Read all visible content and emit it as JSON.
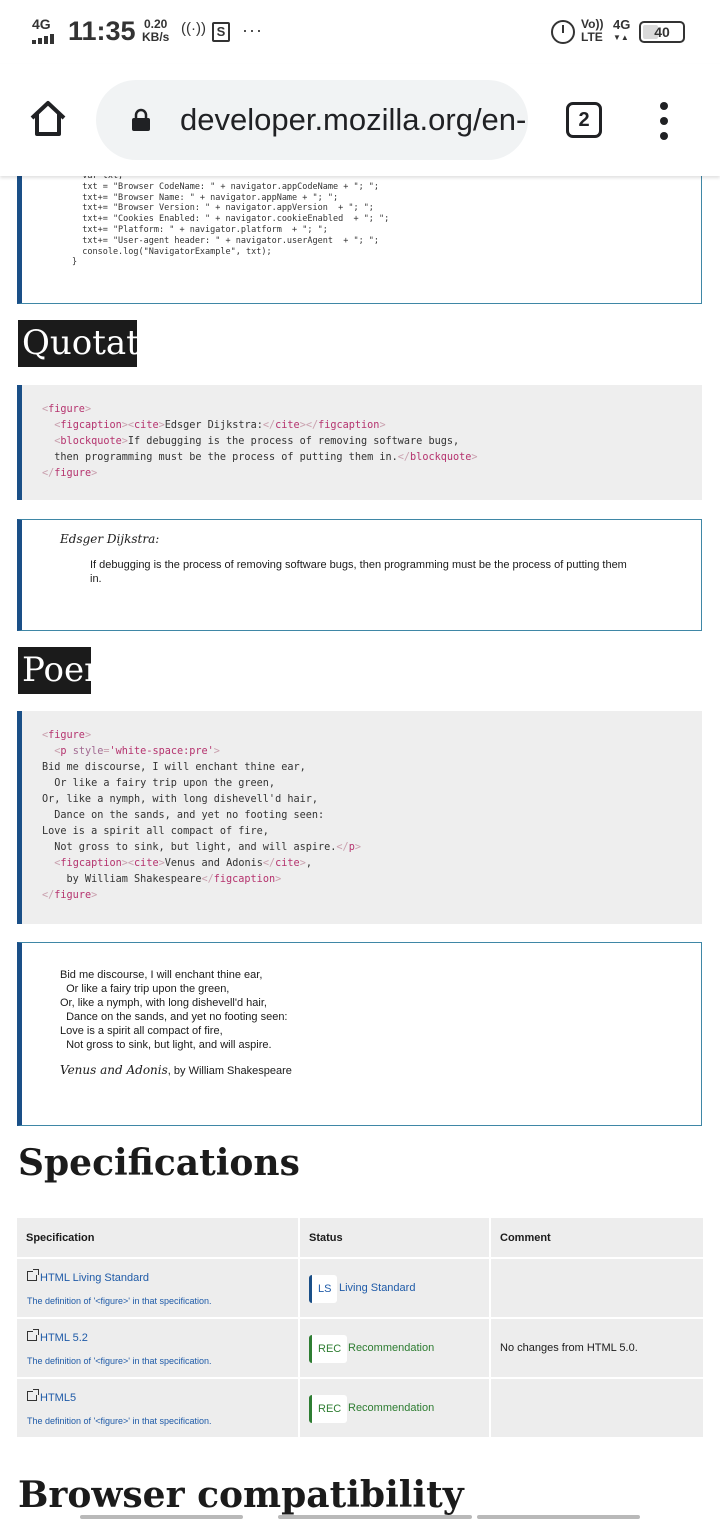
{
  "status_bar": {
    "network": "4G",
    "time": "11:35",
    "speed_value": "0.20",
    "speed_unit": "KB/s",
    "hotspot": "((·))",
    "sim_badge": "S",
    "more": "···",
    "volte_top": "Vo))",
    "volte_bottom": "LTE",
    "network2_top": "4G",
    "network2_bottom": "▼▲",
    "battery": "40",
    "battery_level_percent": 40
  },
  "browser": {
    "url": "developer.mozilla.org/en-US/docs/Web/HTML/Element/figure",
    "tab_count": "2"
  },
  "code_top": {
    "lines": [
      "  var txt;",
      "  txt = \"Browser CodeName: \" + navigator.appCodeName + \"; \";",
      "  txt+= \"Browser Name: \" + navigator.appName + \"; \";",
      "  txt+= \"Browser Version: \" + navigator.appVersion  + \"; \";",
      "  txt+= \"Cookies Enabled: \" + navigator.cookieEnabled  + \"; \";",
      "  txt+= \"Platform: \" + navigator.platform  + \"; \";",
      "  txt+= \"User-agent header: \" + navigator.userAgent  + \"; \";",
      "  console.log(\"NavigatorExample\", txt);",
      "}"
    ]
  },
  "quotation": {
    "heading": "Quotations",
    "code": {
      "l1_tag": "figure",
      "l2_tag1": "figcaption",
      "l2_tag2": "cite",
      "l2_text": "Edsger Dijkstra:",
      "l2_close1": "cite",
      "l2_close2": "figcaption",
      "l3_tag": "blockquote",
      "l3_text": "If debugging is the process of removing software bugs,",
      "l4_text": "then programming must be the process of putting them in.",
      "l4_close": "blockquote",
      "l5_close": "figure"
    },
    "demo": {
      "caption": "Edsger Dijkstra:",
      "quote": "If debugging is the process of removing software bugs, then programming must be the process of putting them in."
    }
  },
  "poem": {
    "heading": "Poems",
    "code": {
      "l1_tag": "figure",
      "l2_tag": "p",
      "l2_attr": "style",
      "l2_val": "'white-space:pre'",
      "lines": [
        "Bid me discourse, I will enchant thine ear,",
        "  Or like a fairy trip upon the green,",
        "Or, like a nymph, with long dishevell'd hair,",
        "  Dance on the sands, and yet no footing seen:",
        "Love is a spirit all compact of fire,"
      ],
      "l8_text": "  Not gross to sink, but light, and will aspire.",
      "l8_close": "p",
      "l9_tag1": "figcaption",
      "l9_tag2": "cite",
      "l9_text": "Venus and Adonis",
      "l9_close": "cite",
      "l9_comma": ",",
      "l10_text": "    by William Shakespeare",
      "l10_close": "figcaption",
      "l11_close": "figure"
    },
    "demo": {
      "text": "Bid me discourse, I will enchant thine ear,\n  Or like a fairy trip upon the green,\nOr, like a nymph, with long dishevell'd hair,\n  Dance on the sands, and yet no footing seen:\nLove is a spirit all compact of fire,\n  Not gross to sink, but light, and will aspire.",
      "cite": "Venus and Adonis",
      "by": ", by William Shakespeare"
    }
  },
  "specifications": {
    "heading": "Specifications",
    "columns": [
      "Specification",
      "Status",
      "Comment"
    ],
    "rows": [
      {
        "spec": "HTML Living Standard",
        "desc": "The definition of '<figure>' in that specification.",
        "badge": "LS",
        "status": "Living Standard",
        "comment": ""
      },
      {
        "spec": "HTML 5.2",
        "desc": "The definition of '<figure>' in that specification.",
        "badge": "REC",
        "status": "Recommendation",
        "comment": "No changes from HTML 5.0."
      },
      {
        "spec": "HTML5",
        "desc": "The definition of '<figure>' in that specification.",
        "badge": "REC",
        "status": "Recommendation",
        "comment": ""
      }
    ],
    "colors": {
      "living": "#1f5ba8",
      "rec": "#2e7d32"
    }
  },
  "browser_compat": {
    "heading": "Browser compatibility"
  }
}
